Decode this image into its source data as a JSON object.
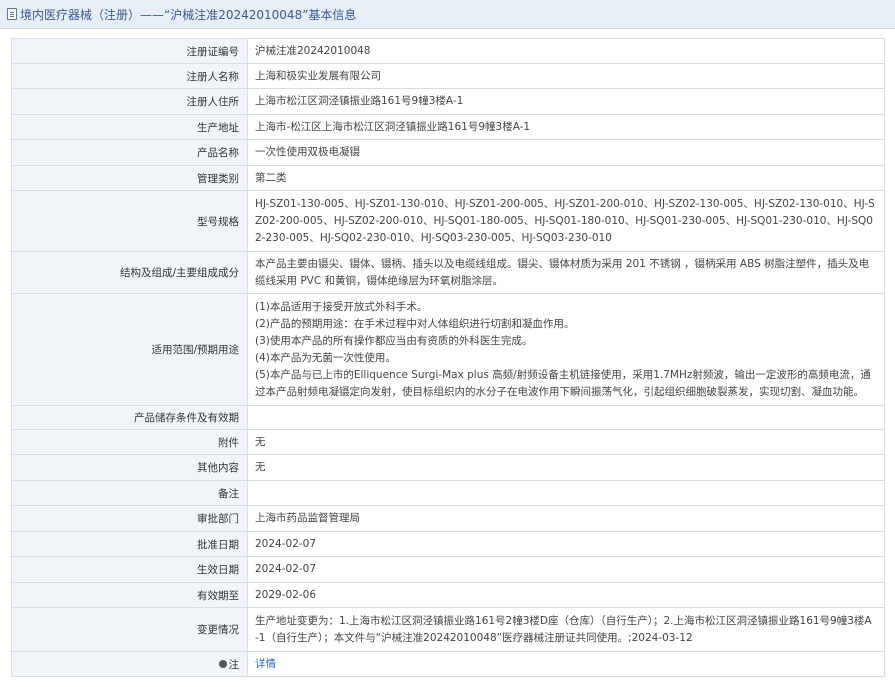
{
  "header": {
    "title": "境内医疗器械（注册）——“沪械注准20242010048”基本信息"
  },
  "rows": [
    {
      "label": "注册证编号",
      "value": "沪械注准20242010048"
    },
    {
      "label": "注册人名称",
      "value": "上海和极实业发展有限公司"
    },
    {
      "label": "注册人住所",
      "value": "上海市松江区洞泾镇振业路161号9幢3楼A-1"
    },
    {
      "label": "生产地址",
      "value": "上海市-松江区上海市松江区洞泾镇振业路161号9幢3楼A-1"
    },
    {
      "label": "产品名称",
      "value": "一次性使用双极电凝镊"
    },
    {
      "label": "管理类别",
      "value": "第二类"
    },
    {
      "label": "型号规格",
      "value": "HJ-SZ01-130-005、HJ-SZ01-130-010、HJ-SZ01-200-005、HJ-SZ01-200-010、HJ-SZ02-130-005、HJ-SZ02-130-010、HJ-SZ02-200-005、HJ-SZ02-200-010、HJ-SQ01-180-005、HJ-SQ01-180-010、HJ-SQ01-230-005、HJ-SQ01-230-010、HJ-SQ02-230-005、HJ-SQ02-230-010、HJ-SQ03-230-005、HJ-SQ03-230-010"
    },
    {
      "label": "结构及组成/主要组成成分",
      "value": "本产品主要由镊尖、镊体、镊柄、插头以及电缆线组成。镊尖、镊体材质为采用 201 不锈钢 ，镊柄采用 ABS 树脂注塑件，插头及电缆线采用 PVC 和黄铜，镊体绝缘层为环氧树脂涂层。"
    },
    {
      "label": "适用范围/预期用途",
      "value": "",
      "lines": [
        "(1)本品适用于接受开放式外科手术。",
        "(2)产品的预期用途：在手术过程中对人体组织进行切割和凝血作用。",
        "(3)使用本产品的所有操作都应当由有资质的外科医生完成。",
        "(4)本产品为无菌一次性使用。",
        "(5)本产品与已上市的Elliquence Surgi-Max plus 高频/射频设备主机链接使用，采用1.7MHz射频波，输出一定波形的高频电流，通过本产品射频电凝镊定向发射，使目标组织内的水分子在电波作用下瞬间振荡气化，引起组织细胞破裂蒸发，实现切割、凝血功能。"
      ]
    },
    {
      "label": "产品储存条件及有效期",
      "value": ""
    },
    {
      "label": "附件",
      "value": "无"
    },
    {
      "label": "其他内容",
      "value": "无"
    },
    {
      "label": "备注",
      "value": ""
    },
    {
      "label": "审批部门",
      "value": "上海市药品监督管理局"
    },
    {
      "label": "批准日期",
      "value": "2024-02-07"
    },
    {
      "label": "生效日期",
      "value": "2024-02-07"
    },
    {
      "label": "有效期至",
      "value": "2029-02-06"
    },
    {
      "label": "变更情况",
      "value": "生产地址变更为：1.上海市松江区洞泾镇振业路161号2幢3楼D座（仓库）（自行生产）；2.上海市松江区洞泾镇振业路161号9幢3楼A -1（自行生产）；本文件与“沪械注准20242010048”医疗器械注册证共同使用。;2024-03-12"
    },
    {
      "label": "注",
      "value": "详情",
      "icon": "note-icon"
    }
  ],
  "colors": {
    "header_bg": "#e8eef6",
    "header_text": "#3a5a8c",
    "label_bg": "#f1f5f9",
    "border": "#d6dde6",
    "link": "#2d6bb3"
  }
}
